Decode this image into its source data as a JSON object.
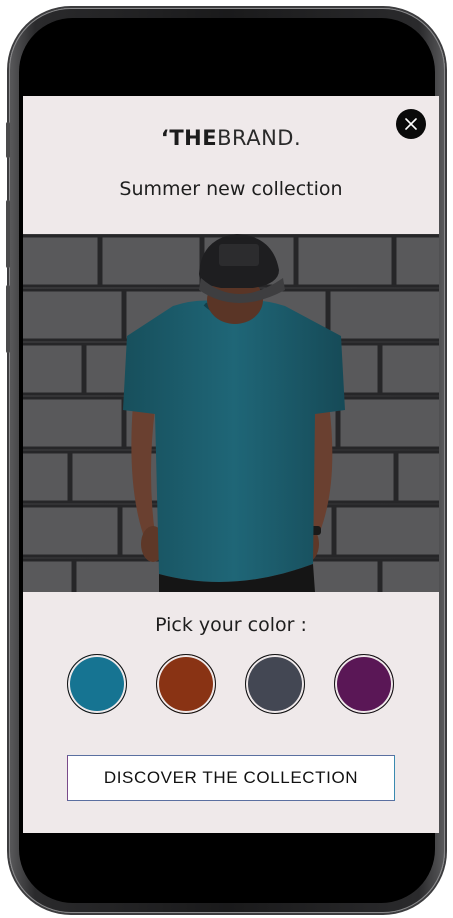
{
  "brand": {
    "prefix": "‘THE",
    "suffix": "BRAND."
  },
  "subtitle": "Summer new collection",
  "pick_label": "Pick your color :",
  "swatches": [
    {
      "name": "teal",
      "color": "#167492"
    },
    {
      "name": "rust",
      "color": "#893314"
    },
    {
      "name": "slate",
      "color": "#434753"
    },
    {
      "name": "purple",
      "color": "#5a1756"
    }
  ],
  "cta_label": "DISCOVER THE COLLECTION",
  "colors": {
    "background": "#efe9ea",
    "shirt": "#1d5f6e"
  }
}
